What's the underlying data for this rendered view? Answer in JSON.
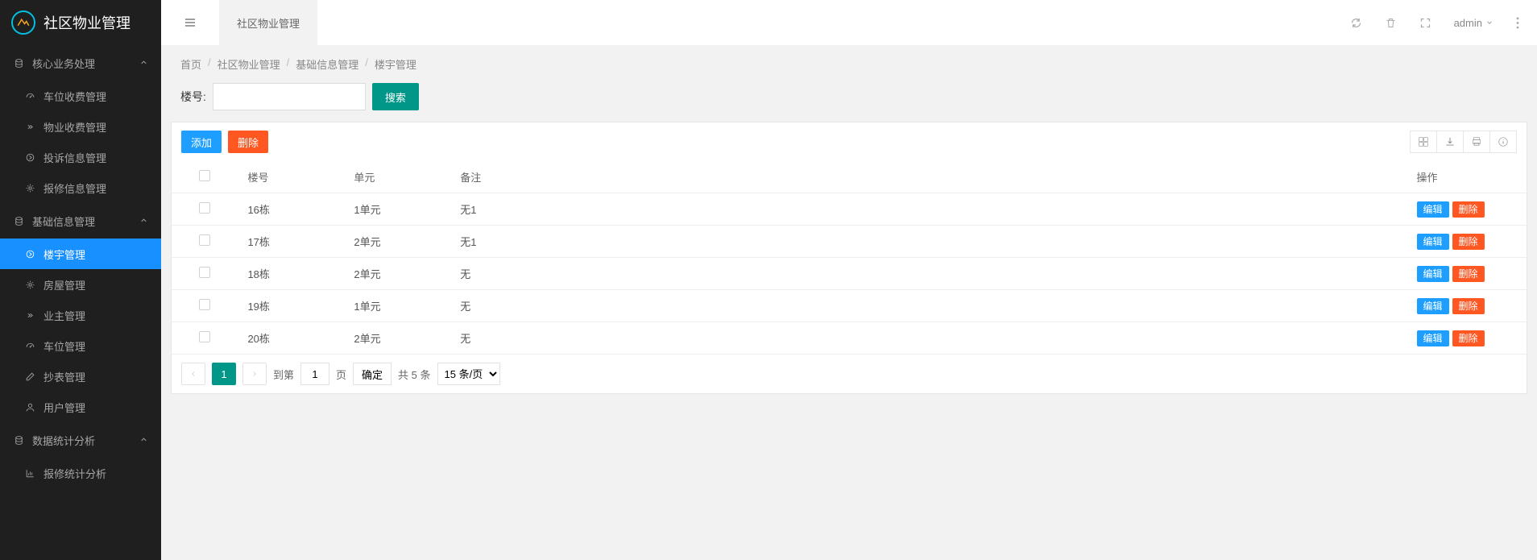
{
  "app_title": "社区物业管理",
  "topbar": {
    "tab_label": "社区物业管理",
    "user_label": "admin"
  },
  "breadcrumb": [
    "首页",
    "社区物业管理",
    "基础信息管理",
    "楼宇管理"
  ],
  "search": {
    "label": "楼号:",
    "button": "搜索"
  },
  "toolbar": {
    "add": "添加",
    "delete": "删除"
  },
  "sidebar": {
    "groups": [
      {
        "label": "核心业务处理",
        "items": [
          {
            "label": "车位收费管理",
            "icon": "dashboard"
          },
          {
            "label": "物业收费管理",
            "icon": "collapse"
          },
          {
            "label": "投诉信息管理",
            "icon": "circle-right"
          },
          {
            "label": "报修信息管理",
            "icon": "gear"
          }
        ]
      },
      {
        "label": "基础信息管理",
        "items": [
          {
            "label": "楼宇管理",
            "icon": "circle-right",
            "active": true
          },
          {
            "label": "房屋管理",
            "icon": "gear"
          },
          {
            "label": "业主管理",
            "icon": "collapse"
          },
          {
            "label": "车位管理",
            "icon": "dashboard"
          },
          {
            "label": "抄表管理",
            "icon": "edit"
          },
          {
            "label": "用户管理",
            "icon": "user"
          }
        ]
      },
      {
        "label": "数据统计分析",
        "items": [
          {
            "label": "报修统计分析",
            "icon": "chart"
          }
        ]
      }
    ]
  },
  "table": {
    "headers": [
      "楼号",
      "单元",
      "备注",
      "操作"
    ],
    "edit_label": "编辑",
    "delete_label": "删除",
    "rows": [
      {
        "bno": "16栋",
        "unit": "1单元",
        "note": "无1"
      },
      {
        "bno": "17栋",
        "unit": "2单元",
        "note": "无1"
      },
      {
        "bno": "18栋",
        "unit": "2单元",
        "note": "无"
      },
      {
        "bno": "19栋",
        "unit": "1单元",
        "note": "无"
      },
      {
        "bno": "20栋",
        "unit": "2单元",
        "note": "无"
      }
    ]
  },
  "pager": {
    "current": "1",
    "goto_label": "到第",
    "goto_value": "1",
    "page_label": "页",
    "confirm": "确定",
    "total": "共 5 条",
    "per_page": "15 条/页"
  }
}
